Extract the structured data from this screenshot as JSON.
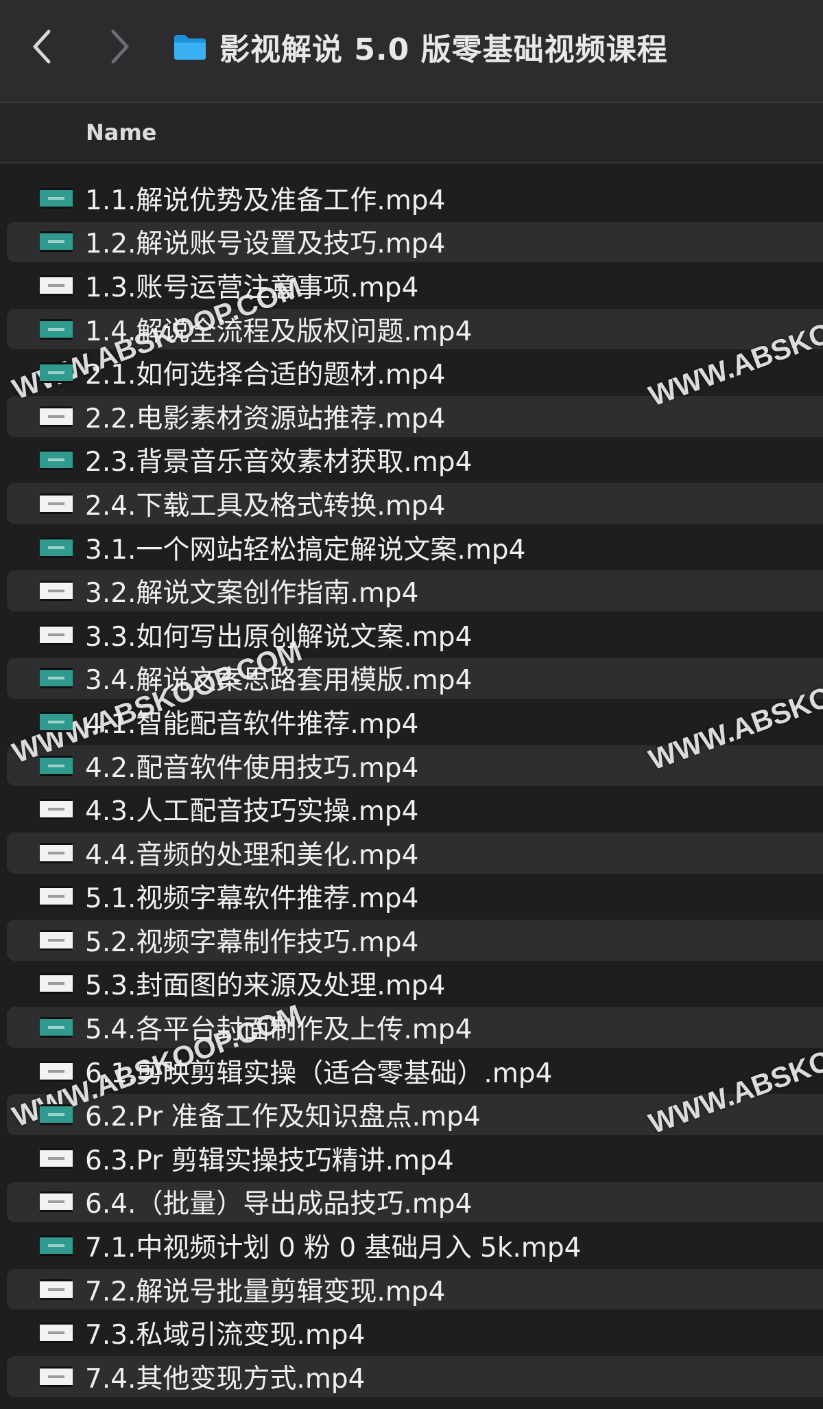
{
  "window": {
    "title": "影视解说 5.0 版零基础视频课程",
    "folder_icon": "folder-icon",
    "folder_color": "#2ea8f0"
  },
  "header": {
    "name_column": "Name"
  },
  "files": [
    {
      "name": "1.1.解说优势及准备工作.mp4",
      "thumb": "green"
    },
    {
      "name": "1.2.解说账号设置及技巧.mp4",
      "thumb": "green"
    },
    {
      "name": "1.3.账号运营注意事项.mp4",
      "thumb": "white"
    },
    {
      "name": "1.4.解说全流程及版权问题.mp4",
      "thumb": "green"
    },
    {
      "name": "2.1.如何选择合适的题材.mp4",
      "thumb": "green"
    },
    {
      "name": "2.2.电影素材资源站推荐.mp4",
      "thumb": "white"
    },
    {
      "name": "2.3.背景音乐音效素材获取.mp4",
      "thumb": "green"
    },
    {
      "name": "2.4.下载工具及格式转换.mp4",
      "thumb": "white"
    },
    {
      "name": "3.1.一个网站轻松搞定解说文案.mp4",
      "thumb": "green"
    },
    {
      "name": "3.2.解说文案创作指南.mp4",
      "thumb": "white"
    },
    {
      "name": "3.3.如何写出原创解说文案.mp4",
      "thumb": "white"
    },
    {
      "name": "3.4.解说文案思路套用模版.mp4",
      "thumb": "green"
    },
    {
      "name": "4.1.智能配音软件推荐.mp4",
      "thumb": "green"
    },
    {
      "name": "4.2.配音软件使用技巧.mp4",
      "thumb": "green"
    },
    {
      "name": "4.3.人工配音技巧实操.mp4",
      "thumb": "white"
    },
    {
      "name": "4.4.音频的处理和美化.mp4",
      "thumb": "white"
    },
    {
      "name": "5.1.视频字幕软件推荐.mp4",
      "thumb": "white"
    },
    {
      "name": "5.2.视频字幕制作技巧.mp4",
      "thumb": "white"
    },
    {
      "name": "5.3.封面图的来源及处理.mp4",
      "thumb": "white"
    },
    {
      "name": "5.4.各平台封面制作及上传.mp4",
      "thumb": "green"
    },
    {
      "name": "6.1.剪映剪辑实操（适合零基础）.mp4",
      "thumb": "white"
    },
    {
      "name": "6.2.Pr 准备工作及知识盘点.mp4",
      "thumb": "green"
    },
    {
      "name": "6.3.Pr 剪辑实操技巧精讲.mp4",
      "thumb": "white"
    },
    {
      "name": "6.4.（批量）导出成品技巧.mp4",
      "thumb": "white"
    },
    {
      "name": "7.1.中视频计划 0 粉 0 基础月入 5k.mp4",
      "thumb": "green"
    },
    {
      "name": "7.2.解说号批量剪辑变现.mp4",
      "thumb": "white"
    },
    {
      "name": "7.3.私域引流变现.mp4",
      "thumb": "white"
    },
    {
      "name": "7.4.其他变现方式.mp4",
      "thumb": "white"
    }
  ],
  "watermarks": [
    "WWW.ABSKOOP.COM",
    "WWW.ABSKOOP.COM",
    "WWW.ABSKOOP.COM",
    "WWW.ABSKO",
    "WWW.ABSKO",
    "WWW.ABSKO"
  ]
}
